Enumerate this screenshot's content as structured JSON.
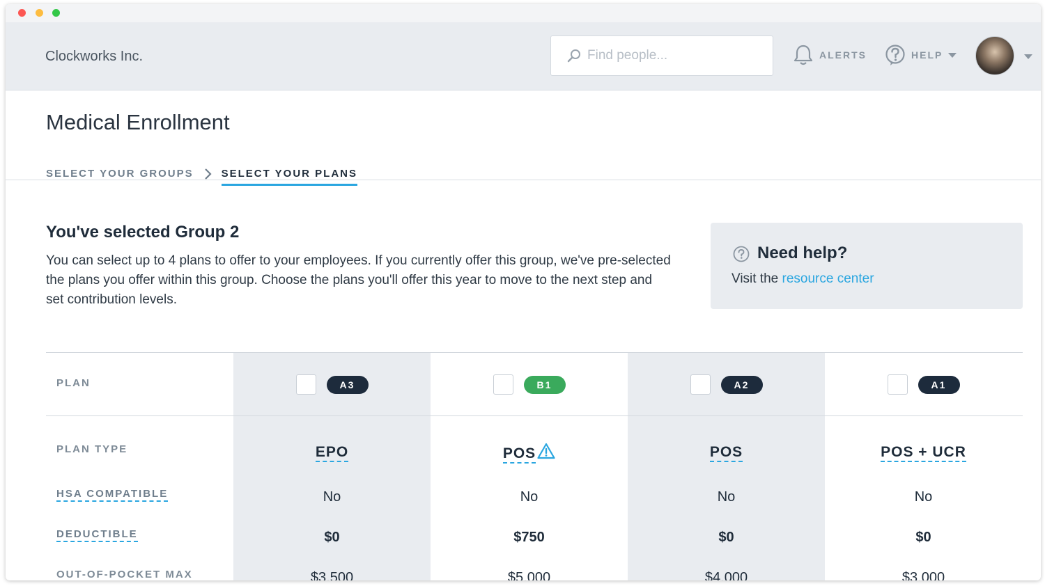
{
  "header": {
    "company": "Clockworks Inc.",
    "search_placeholder": "Find people...",
    "alerts_label": "ALERTS",
    "help_label": "HELP"
  },
  "page": {
    "title": "Medical Enrollment",
    "steps": [
      {
        "label": "SELECT YOUR GROUPS",
        "active": false
      },
      {
        "label": "SELECT YOUR PLANS",
        "active": true
      }
    ]
  },
  "intro": {
    "title": "You've selected Group 2",
    "description": "You can select up to 4 plans to offer to your employees. If you currently offer this group, we've pre-selected the plans you offer within this group. Choose the plans you'll offer this year to move to the next step and set contribution levels."
  },
  "helpbox": {
    "title": "Need help?",
    "text": "Visit the",
    "link": "resource center"
  },
  "table": {
    "row_labels": {
      "plan": "PLAN",
      "plan_type": "PLAN TYPE",
      "hsa": "HSA COMPATIBLE",
      "deductible": "DEDUCTIBLE",
      "oop": "OUT-OF-POCKET MAX"
    },
    "plans": [
      {
        "badge": "A3",
        "badge_color": "#1d2b3c",
        "type": "EPO",
        "hsa": "No",
        "deductible": "$0",
        "oop": "$3,500",
        "warning": false
      },
      {
        "badge": "B1",
        "badge_color": "#3aaa5c",
        "type": "POS",
        "hsa": "No",
        "deductible": "$750",
        "oop": "$5,000",
        "warning": true
      },
      {
        "badge": "A2",
        "badge_color": "#1d2b3c",
        "type": "POS",
        "hsa": "No",
        "deductible": "$0",
        "oop": "$4,000",
        "warning": false
      },
      {
        "badge": "A1",
        "badge_color": "#1d2b3c",
        "type": "POS + UCR",
        "hsa": "No",
        "deductible": "$0",
        "oop": "$3,000",
        "warning": false
      }
    ]
  },
  "icons": {
    "search": "search-icon",
    "alerts": "bell-icon",
    "help": "question-circle-icon",
    "warning": "warning-triangle-icon"
  },
  "colors": {
    "accent": "#2aa6e0",
    "dark_badge": "#1d2b3c",
    "green_badge": "#3aaa5c",
    "column_shade": "#e9ecf0"
  }
}
